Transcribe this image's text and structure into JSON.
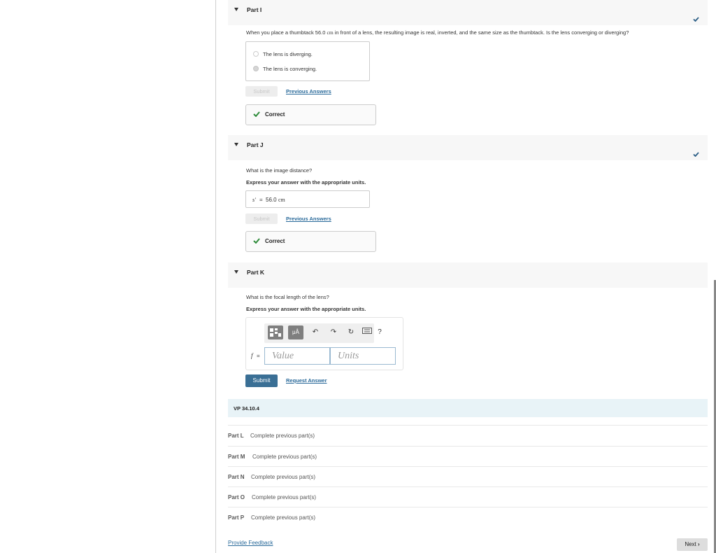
{
  "partI": {
    "title": "Part I",
    "question_pre": "When you place a thumbtack 56.0 ",
    "question_unit": "cm",
    "question_post": " in front of a lens, the resulting image is real, inverted, and the same size as the thumbtack. Is the lens converging or diverging?",
    "choices": [
      "The lens is diverging.",
      "The lens is converging."
    ],
    "selected_index": 1,
    "submit_label": "Submit",
    "previous_answers": "Previous Answers",
    "result": "Correct"
  },
  "partJ": {
    "title": "Part J",
    "question": "What is the image distance?",
    "instruction": "Express your answer with the appropriate units.",
    "variable": "s′",
    "equals": "=",
    "value": "56.0",
    "unit": "cm",
    "submit_label": "Submit",
    "previous_answers": "Previous Answers",
    "result": "Correct"
  },
  "partK": {
    "title": "Part K",
    "question": "What is the focal length of the lens?",
    "instruction": "Express your answer with the appropriate units.",
    "toolbar": {
      "templates_icon": "templates-icon",
      "units_label": "μÅ",
      "undo_icon": "undo-icon",
      "redo_icon": "redo-icon",
      "reset_icon": "reset-icon",
      "keyboard_icon": "keyboard-icon",
      "help_label": "?"
    },
    "variable": "f",
    "equals": "=",
    "value_placeholder": "Value",
    "units_placeholder": "Units",
    "submit_label": "Submit",
    "request_answer": "Request Answer"
  },
  "section": {
    "title": "VP 34.10.4"
  },
  "locked_parts": [
    {
      "name": "Part L",
      "status": "Complete previous part(s)"
    },
    {
      "name": "Part M",
      "status": "Complete previous part(s)"
    },
    {
      "name": "Part N",
      "status": "Complete previous part(s)"
    },
    {
      "name": "Part O",
      "status": "Complete previous part(s)"
    },
    {
      "name": "Part P",
      "status": "Complete previous part(s)"
    }
  ],
  "footer": {
    "feedback_link": "Provide Feedback",
    "next_label": "Next"
  },
  "colors": {
    "accent": "#3a6f95",
    "correct_green": "#2e8b3a",
    "check_blue": "#2a5d85"
  }
}
